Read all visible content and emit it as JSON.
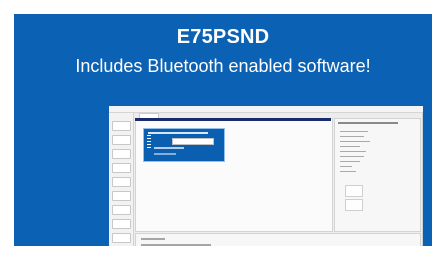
{
  "promo": {
    "title": "E75PSND",
    "subtitle": "Includes Bluetooth enabled software!"
  },
  "colors": {
    "banner_blue": "#0b61b3",
    "text_white": "#ffffff"
  },
  "screenshot": {
    "description": "software window screenshot",
    "sidebar_icon": "app-sidebar",
    "popup_icon": "dialog-icon"
  }
}
